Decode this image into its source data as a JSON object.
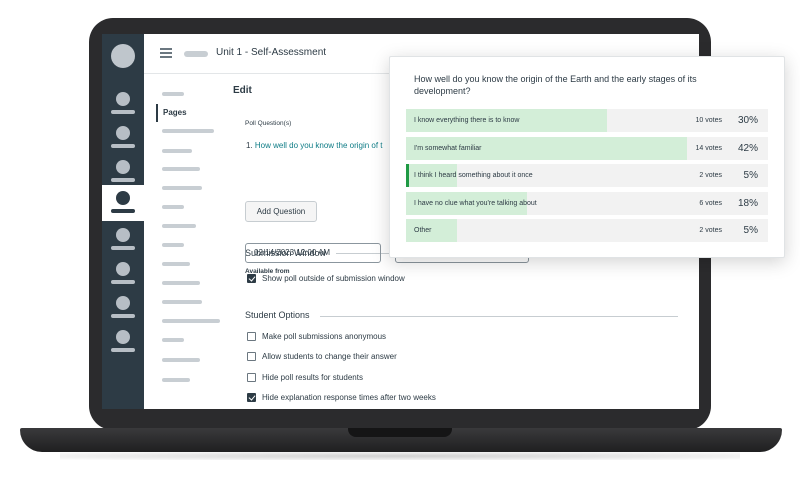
{
  "breadcrumb": {
    "title": "Unit 1 - Self-Assessment"
  },
  "subnav": {
    "active_label": "Pages"
  },
  "editor": {
    "heading": "Edit",
    "poll_questions_label": "Poll Question(s)",
    "question_number": "1.",
    "question_text": "How well do you know the origin of t",
    "add_question_label": "Add Question",
    "submission_window_title": "Submission Window",
    "available_from_label": "Available from",
    "available_from_value": "02/14/2023 12:00 AM",
    "show_outside_window_label": "Show poll outside of submission window",
    "show_outside_window_checked": true,
    "student_options_title": "Student Options",
    "options": [
      {
        "label": "Make poll submissions anonymous",
        "checked": false
      },
      {
        "label": "Allow students to change their answer",
        "checked": false
      },
      {
        "label": "Hide poll results for students",
        "checked": false
      },
      {
        "label": "Hide explanation response times after two weeks",
        "checked": true
      }
    ]
  },
  "poll": {
    "question": "How well do you know the origin of the Earth and the early stages of its development?",
    "accent_color": "#1f9a44",
    "bar_color": "#d3eed8",
    "answers": [
      {
        "option": "I know everything there is to know",
        "votes": "10 votes",
        "percent": "30%",
        "value": 0.3,
        "selected": false
      },
      {
        "option": "I'm somewhat familiar",
        "votes": "14 votes",
        "percent": "42%",
        "value": 0.42,
        "selected": false
      },
      {
        "option": "I think I heard something about it once",
        "votes": "2 votes",
        "percent": "5%",
        "value": 0.05,
        "selected": true
      },
      {
        "option": "I have no clue what you're talking about",
        "votes": "6 votes",
        "percent": "18%",
        "value": 0.18,
        "selected": false
      },
      {
        "option": "Other",
        "votes": "2 votes",
        "percent": "5%",
        "value": 0.05,
        "selected": false
      }
    ]
  }
}
